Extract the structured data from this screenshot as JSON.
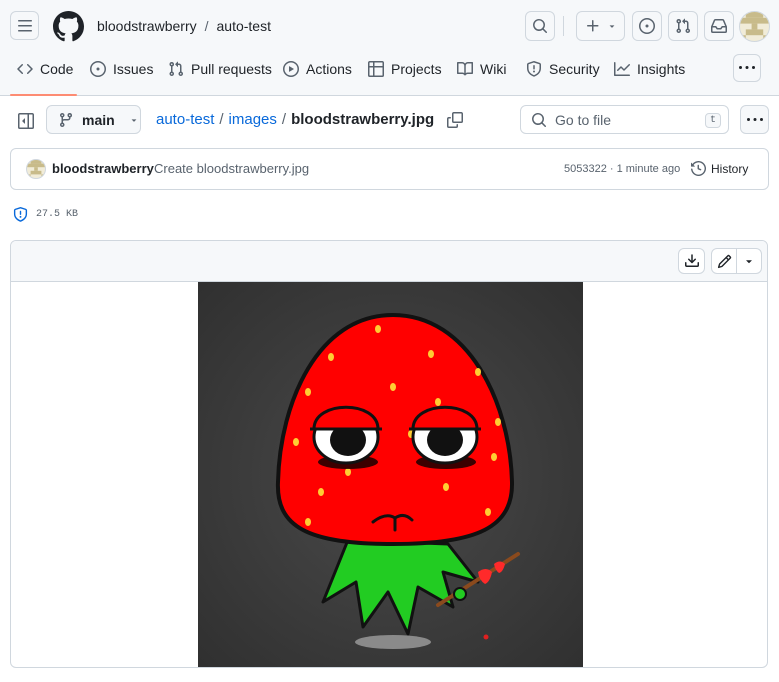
{
  "header": {
    "owner": "bloodstrawberry",
    "separator": "/",
    "repo": "auto-test",
    "icons": [
      "hamburger-icon",
      "github-logo-icon",
      "search-icon",
      "plus-icon",
      "caret-down-icon",
      "issue-icon",
      "pull-request-icon",
      "inbox-icon",
      "avatar"
    ]
  },
  "tabs": [
    {
      "label": "Code",
      "icon": "code-icon",
      "active": true
    },
    {
      "label": "Issues",
      "icon": "issue-opened-icon"
    },
    {
      "label": "Pull requests",
      "icon": "git-pull-request-icon"
    },
    {
      "label": "Actions",
      "icon": "play-icon"
    },
    {
      "label": "Projects",
      "icon": "table-icon"
    },
    {
      "label": "Wiki",
      "icon": "book-icon"
    },
    {
      "label": "Security",
      "icon": "shield-icon"
    },
    {
      "label": "Insights",
      "icon": "graph-icon"
    }
  ],
  "file_nav": {
    "branch": "main",
    "breadcrumb": {
      "repo": "auto-test",
      "sep1": "/",
      "folder": "images",
      "sep2": "/",
      "file": "bloodstrawberry.jpg"
    },
    "search_placeholder": "Go to file",
    "search_shortcut": "t"
  },
  "commit": {
    "author": "bloodstrawberry",
    "message": "Create bloodstrawberry.jpg",
    "sha_time": "5053322 · 1 minute ago",
    "history_label": "History"
  },
  "file_meta": {
    "size": "27.5 KB"
  },
  "colors": {
    "accent_link": "#0969da",
    "tab_underline": "#fd8c73",
    "border": "#d0d7de",
    "strawberry_red": "#ff0000",
    "leaf_green": "#22cc22",
    "image_bg": "#3a3a3a"
  }
}
